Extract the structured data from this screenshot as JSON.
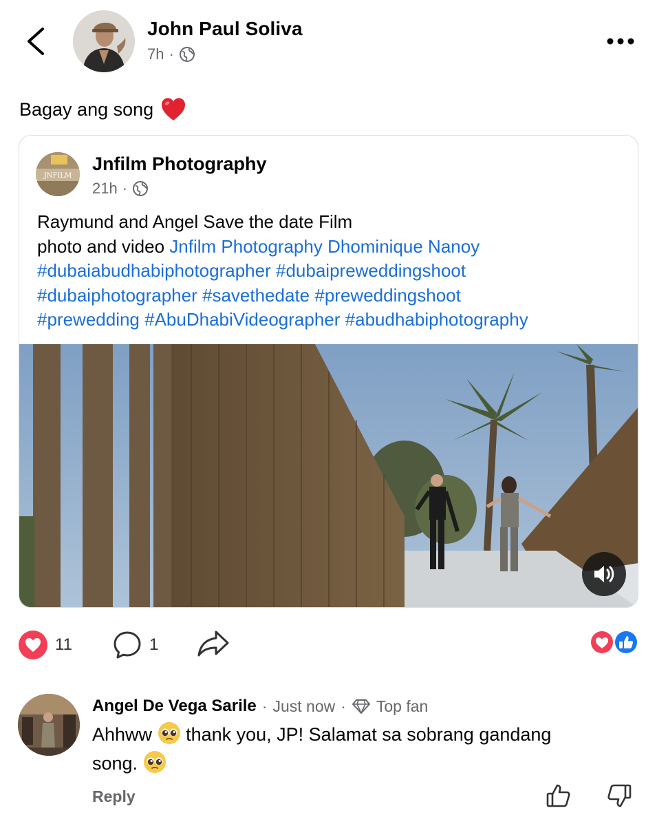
{
  "post": {
    "author": "John Paul Soliva",
    "time": "7h",
    "separator": "·",
    "privacy_icon": "globe-icon",
    "text": "Bagay ang song",
    "emoji_icon": "red-heart-icon"
  },
  "shared_post": {
    "page_name": "Jnfilm Photography",
    "avatar_text": "JNFILM",
    "time": "21h",
    "separator": "·",
    "text_line1": "Raymund and Angel Save the date Film",
    "text_line2_prefix": "photo and video ",
    "tags": {
      "tag1": "Jnfilm Photography",
      "tag2": "Dhominique Nanoy",
      "tag3": "#dubaiabudhabiphotographer",
      "tag4": "#dubaipreweddingshoot",
      "tag5": "#dubaiphotographer",
      "tag6": "#savethedate",
      "tag7": "#preweddingshoot",
      "tag8": "#prewedding",
      "tag9": "#AbuDhabiVideographer",
      "tag10": "#abudhabiphotography"
    },
    "video_control_icon": "volume-icon"
  },
  "actions": {
    "reaction_count": "11",
    "comment_count": "1",
    "reaction_summary_icons": [
      "love-reaction-icon",
      "like-reaction-icon"
    ]
  },
  "comment": {
    "author": "Angel De Vega Sarile",
    "separator": "·",
    "time": "Just now",
    "badge": "Top fan",
    "badge_icon": "diamond-icon",
    "text_part1": "Ahhww",
    "text_part2": "thank you, JP! Salamat sa sobrang gandang",
    "text_part3": "song.",
    "emoji_icon": "pleading-face-icon",
    "reply_label": "Reply"
  },
  "colors": {
    "link": "#1a6ed8",
    "meta": "#65676b",
    "love": "#f33e58",
    "like": "#1877f2"
  }
}
